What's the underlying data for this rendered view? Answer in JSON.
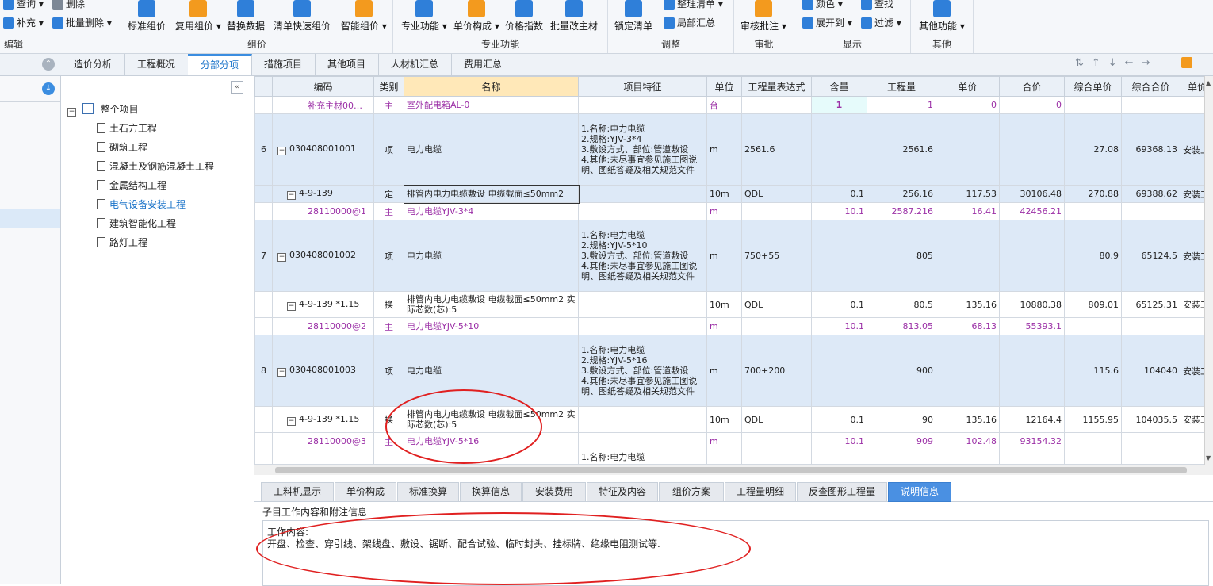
{
  "ribbon": {
    "edit": {
      "label": "编辑",
      "query": "查询",
      "delete": "删除",
      "supplement": "补充",
      "batch_delete": "批量删除"
    },
    "group": {
      "label": "组价",
      "buttons": [
        "标准组价",
        "复用组价",
        "替换数据",
        "清单快速组价",
        "智能组价"
      ]
    },
    "pro": {
      "label": "专业功能",
      "buttons": [
        "专业功能",
        "单价构成",
        "价格指数",
        "批量改主材"
      ]
    },
    "adjust": {
      "label": "调整",
      "buttons": [
        "锁定清单",
        "整理清单",
        "局部汇总"
      ]
    },
    "review": {
      "label": "审批",
      "buttons": [
        "审核批注"
      ]
    },
    "display": {
      "label": "显示",
      "color": "颜色",
      "find": "查找",
      "expand": "展开到",
      "filter": "过滤"
    },
    "other": {
      "label": "其他",
      "buttons": [
        "其他功能"
      ]
    }
  },
  "tabs": [
    "造价分析",
    "工程概况",
    "分部分项",
    "措施项目",
    "其他项目",
    "人材机汇总",
    "费用汇总"
  ],
  "tree": {
    "root": "整个项目",
    "items": [
      "土石方工程",
      "砌筑工程",
      "混凝土及钢筋混凝土工程",
      "金属结构工程",
      "电气设备安装工程",
      "建筑智能化工程",
      "路灯工程"
    ]
  },
  "grid": {
    "headers": [
      "编码",
      "类别",
      "名称",
      "项目特征",
      "单位",
      "工程量表达式",
      "含量",
      "工程量",
      "单价",
      "合价",
      "综合单价",
      "综合合价",
      "单价"
    ],
    "rows": [
      {
        "no": "",
        "code": "补充主材00…",
        "type": "主",
        "name": "室外配电箱AL-0",
        "feat": "",
        "unit": "台",
        "expr": "",
        "qty_ratio": "1",
        "qty": "1",
        "price": "0",
        "total": "0",
        "cprice": "",
        "ctotal": "",
        "extra": ""
      },
      {
        "no": "6",
        "code": "030408001001",
        "type": "项",
        "name": "电力电缆",
        "feat": "1.名称:电力电缆\n2.规格:YJV-3*4\n3.敷设方式、部位:管道敷设\n4.其他:未尽事宜参见施工图说明、图纸答疑及相关规范文件",
        "unit": "m",
        "expr": "2561.6",
        "qty_ratio": "",
        "qty": "2561.6",
        "price": "",
        "total": "",
        "cprice": "27.08",
        "ctotal": "69368.13",
        "extra": "安装工"
      },
      {
        "no": "",
        "code": "4-9-139",
        "type": "定",
        "name": "排管内电力电缆敷设 电缆截面≤50mm2",
        "feat": "",
        "unit": "10m",
        "expr": "QDL",
        "qty_ratio": "0.1",
        "qty": "256.16",
        "price": "117.53",
        "total": "30106.48",
        "cprice": "270.88",
        "ctotal": "69388.62",
        "extra": "安装工"
      },
      {
        "no": "",
        "code": "28110000@1",
        "type": "主",
        "name": "电力电缆YJV-3*4",
        "feat": "",
        "unit": "m",
        "expr": "",
        "qty_ratio": "10.1",
        "qty": "2587.216",
        "price": "16.41",
        "total": "42456.21",
        "cprice": "",
        "ctotal": "",
        "extra": ""
      },
      {
        "no": "7",
        "code": "030408001002",
        "type": "项",
        "name": "电力电缆",
        "feat": "1.名称:电力电缆\n2.规格:YJV-5*10\n3.敷设方式、部位:管道敷设\n4.其他:未尽事宜参见施工图说明、图纸答疑及相关规范文件",
        "unit": "m",
        "expr": "750+55",
        "qty_ratio": "",
        "qty": "805",
        "price": "",
        "total": "",
        "cprice": "80.9",
        "ctotal": "65124.5",
        "extra": "安装工"
      },
      {
        "no": "",
        "code": "4-9-139 *1.15",
        "type": "换",
        "name": "排管内电力电缆敷设 电缆截面≤50mm2 实际芯数(芯):5",
        "feat": "",
        "unit": "10m",
        "expr": "QDL",
        "qty_ratio": "0.1",
        "qty": "80.5",
        "price": "135.16",
        "total": "10880.38",
        "cprice": "809.01",
        "ctotal": "65125.31",
        "extra": "安装工"
      },
      {
        "no": "",
        "code": "28110000@2",
        "type": "主",
        "name": "电力电缆YJV-5*10",
        "feat": "",
        "unit": "m",
        "expr": "",
        "qty_ratio": "10.1",
        "qty": "813.05",
        "price": "68.13",
        "total": "55393.1",
        "cprice": "",
        "ctotal": "",
        "extra": ""
      },
      {
        "no": "8",
        "code": "030408001003",
        "type": "项",
        "name": "电力电缆",
        "feat": "1.名称:电力电缆\n2.规格:YJV-5*16\n3.敷设方式、部位:管道敷设\n4.其他:未尽事宜参见施工图说明、图纸答疑及相关规范文件",
        "unit": "m",
        "expr": "700+200",
        "qty_ratio": "",
        "qty": "900",
        "price": "",
        "total": "",
        "cprice": "115.6",
        "ctotal": "104040",
        "extra": "安装工"
      },
      {
        "no": "",
        "code": "4-9-139 *1.15",
        "type": "换",
        "name": "排管内电力电缆敷设 电缆截面≤50mm2 实际芯数(芯):5",
        "feat": "",
        "unit": "10m",
        "expr": "QDL",
        "qty_ratio": "0.1",
        "qty": "90",
        "price": "135.16",
        "total": "12164.4",
        "cprice": "1155.95",
        "ctotal": "104035.5",
        "extra": "安装工"
      },
      {
        "no": "",
        "code": "28110000@3",
        "type": "主",
        "name": "电力电缆YJV-5*16",
        "feat": "",
        "unit": "m",
        "expr": "",
        "qty_ratio": "10.1",
        "qty": "909",
        "price": "102.48",
        "total": "93154.32",
        "cprice": "",
        "ctotal": "",
        "extra": ""
      },
      {
        "no": "",
        "code": "",
        "type": "",
        "name": "",
        "feat": "1.名称:电力电缆",
        "unit": "",
        "expr": "",
        "qty_ratio": "",
        "qty": "",
        "price": "",
        "total": "",
        "cprice": "",
        "ctotal": "",
        "extra": ""
      }
    ]
  },
  "bottom_tabs": [
    "工料机显示",
    "单价构成",
    "标准换算",
    "换算信息",
    "安装费用",
    "特征及内容",
    "组价方案",
    "工程量明细",
    "反查图形工程量",
    "说明信息"
  ],
  "note": {
    "title": "子目工作内容和附注信息",
    "line1": "工作内容:",
    "line2": "开盘、检查、穿引线、架线盘、敷设、锯断、配合试验、临时封头、挂标牌、绝缘电阻测试等."
  },
  "colors": {
    "accent": "#4a90e2",
    "item_row": "#dde9f7",
    "main_material": "#9b2fa6",
    "annotation": "#e02020"
  }
}
